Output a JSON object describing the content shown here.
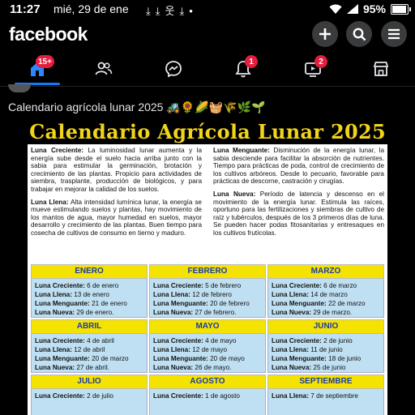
{
  "status": {
    "time": "11:27",
    "date": "mié, 29 de ene",
    "battery": "95%",
    "battery_level": 0.95,
    "icons": [
      "download-icon",
      "download-icon",
      "person-icon",
      "download-icon",
      "dot-icon"
    ]
  },
  "header": {
    "logo": "facebook",
    "buttons": [
      "plus-icon",
      "search-icon",
      "menu-icon"
    ]
  },
  "nav": {
    "home_badge": "15+",
    "notifications_badge": "1",
    "video_badge": "2"
  },
  "post": {
    "caption": "Calendario agrícola lunar 2025 🚜🌻🌽🧺🌾🌿🌱"
  },
  "document": {
    "title": "Calendario Agrícola Lunar 2025",
    "paragraphs": {
      "left": [
        {
          "term": "Luna Creciente:",
          "text": " La luminosidad lunar aumenta y la energía sube desde el suelo hacia arriba junto con la sabia para estimular la germinación, brotación y crecimiento de las plantas. Propicio para actividades de siembra, trasplante, producción de biológicos, y para trabajar en mejorar la calidad de los suelos."
        },
        {
          "term": "Luna Llena:",
          "text": " Alta intensidad lumínica lunar, la energía se mueve estimulando suelos y plantas, hay movimiento de los mantos de agua, mayor humedad en suelos, mayor desarrollo y crecimiento de las plantas. Buen tiempo para cosecha de cultivos de consumo en tierno y maduro."
        }
      ],
      "right": [
        {
          "term": "Luna Menguante:",
          "text": " Disminución de la energía lunar, la sabia desciende para facilitar la absorción de nutrientes. Tiempo para prácticas de poda, control de crecimiento de los cultivos arbóreos. Desde lo pecuario, favorable para prácticas de descorne, castración y cirugías."
        },
        {
          "term": "Luna Nueva:",
          "text": " Período de latencia y descenso en el movimiento de la energía lunar. Estimula las raíces, oportuno para las fertilizaciones y siembras de cultivo de raíz y tubérculos, después de los 3 primeros días de luna. Se pueden hacer podas fitosanitarias y entresaques en los cultivos frutícolas."
        }
      ]
    },
    "months": [
      {
        "name": "ENERO",
        "lines": [
          [
            "Luna Creciente:",
            "6 de enero"
          ],
          [
            "Luna Llena:",
            "13 de enero"
          ],
          [
            "Luna Menguante:",
            "21 de enero"
          ],
          [
            "Luna Nueva:",
            "29 de enero."
          ]
        ]
      },
      {
        "name": "FEBRERO",
        "lines": [
          [
            "Luna Creciente:",
            "5 de febrero"
          ],
          [
            "Luna Llena:",
            "12 de febrero"
          ],
          [
            "Luna Menguante:",
            "20 de febrero"
          ],
          [
            "Luna Nueva:",
            "27 de febrero."
          ]
        ]
      },
      {
        "name": "MARZO",
        "lines": [
          [
            "Luna Creciente:",
            "6 de marzo"
          ],
          [
            "Luna Llena:",
            "14 de marzo"
          ],
          [
            "Luna Menguante:",
            "22 de marzo"
          ],
          [
            "Luna Nueva:",
            "29 de marzo."
          ]
        ]
      },
      {
        "name": "ABRIL",
        "lines": [
          [
            "Luna Creciente:",
            "4 de abril"
          ],
          [
            "Luna Llena:",
            "12 de abril"
          ],
          [
            "Luna Menguante:",
            "20 de marzo"
          ],
          [
            "Luna Nueva:",
            "27 de abril."
          ]
        ]
      },
      {
        "name": "MAYO",
        "lines": [
          [
            "Luna Creciente:",
            "4 de mayo"
          ],
          [
            "Luna Llena:",
            "12 de mayo"
          ],
          [
            "Luna Menguante:",
            "20 de mayo"
          ],
          [
            "Luna Nueva:",
            "26 de mayo."
          ]
        ]
      },
      {
        "name": "JUNIO",
        "lines": [
          [
            "Luna Creciente:",
            "2 de junio"
          ],
          [
            "Luna Llena:",
            "11 de junio"
          ],
          [
            "Luna Menguante:",
            "18 de junio"
          ],
          [
            "Luna Nueva:",
            "25 de junio"
          ]
        ]
      },
      {
        "name": "JULIO",
        "lines": [
          [
            "Luna Creciente:",
            "2 de julio"
          ]
        ]
      },
      {
        "name": "AGOSTO",
        "lines": [
          [
            "Luna Creciente:",
            "1 de agosto"
          ]
        ]
      },
      {
        "name": "SEPTIEMBRE",
        "lines": [
          [
            "Luna Llena:",
            "7 de septiembre"
          ]
        ]
      }
    ]
  }
}
